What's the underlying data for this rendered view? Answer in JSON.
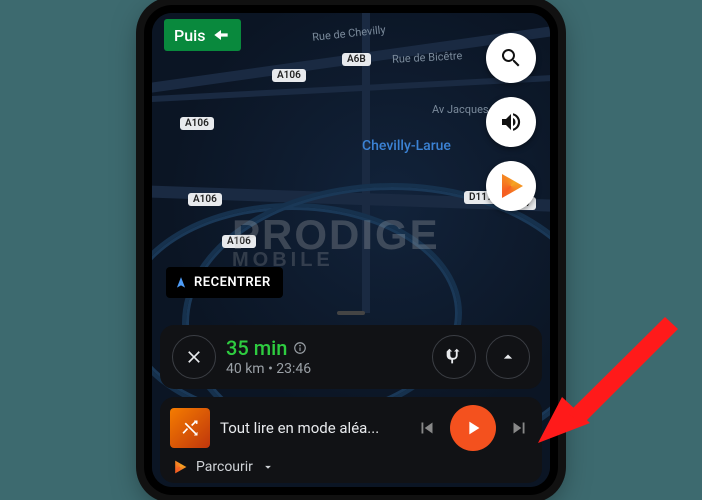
{
  "nav_banner": {
    "label": "Puis"
  },
  "map": {
    "city": "Chevilly-Larue",
    "streets": [
      "Rue de Chevilly",
      "Rue de Bicêtre",
      "Av Jacques B..."
    ],
    "shields": [
      "A106",
      "A6B",
      "A106",
      "A106",
      "A106",
      "D117",
      "D7"
    ]
  },
  "recenter": {
    "label": "RECENTRER"
  },
  "trip": {
    "time": "35 min",
    "distance": "40 km",
    "separator": "•",
    "eta": "23:46"
  },
  "music": {
    "track_title": "Tout lire en mode aléa...",
    "browse_label": "Parcourir"
  },
  "watermark": {
    "line1": "PRODIGE",
    "line2": "MOBILE"
  },
  "icons": {
    "search": "search-icon",
    "volume": "volume-icon",
    "music_app": "google-play-music-icon",
    "close": "close-icon",
    "alt_routes": "alternate-routes-icon",
    "chevron_up": "chevron-up-icon",
    "prev": "skip-previous-icon",
    "play": "play-icon",
    "next": "skip-next-icon",
    "shuffle": "shuffle-icon",
    "turn_left": "turn-left-icon",
    "nav_arrow": "navigation-arrow-icon",
    "info": "info-icon",
    "chevron_down": "chevron-down-icon"
  }
}
